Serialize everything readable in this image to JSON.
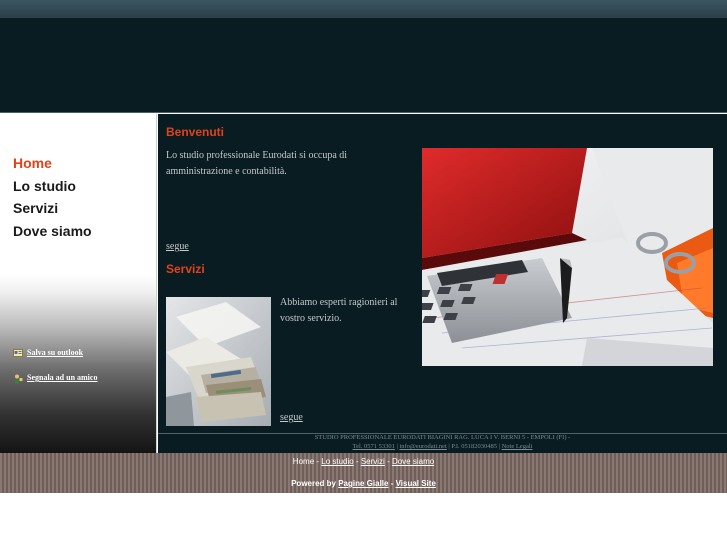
{
  "sidebar": {
    "nav": [
      "Home",
      "Lo studio",
      "Servizi",
      "Dove siamo"
    ],
    "links": {
      "outlook": "Salva su outlook",
      "friend": "Segnala ad un amico"
    }
  },
  "welcome": {
    "title": "Benvenuti",
    "text": "Lo studio professionale Eurodati si occupa di amministrazione e contabilità.",
    "more": "segue"
  },
  "services": {
    "title": "Servizi",
    "text": "Abbiamo esperti ragionieri al vostro servizio.",
    "more": "segue"
  },
  "footer_info": {
    "line1": "STUDIO PROFESSIONALE EURODATI BIAGINI RAG. LUCA I V. BERNI 5 - EMPOLI (FI) -",
    "tel": "Tel. 0571 53301",
    "sep1": " | ",
    "email": "info@eurodati.net",
    "piva": " | P.I. 05182030485 | ",
    "notes": "Note Legali"
  },
  "bottom": {
    "nav": [
      "Home",
      "Lo studio",
      "Servizi",
      "Dove siamo"
    ],
    "sep": " - ",
    "powered_label": "Powered by ",
    "pagine": "Pagine Gialle",
    "dash": " - ",
    "visual": "Visual Site"
  },
  "colors": {
    "accent": "#e0431a",
    "background": "#081c22",
    "text": "#c5c9ca"
  },
  "icons": {
    "outlook": "outlook-card-icon",
    "friend": "person-icon"
  }
}
